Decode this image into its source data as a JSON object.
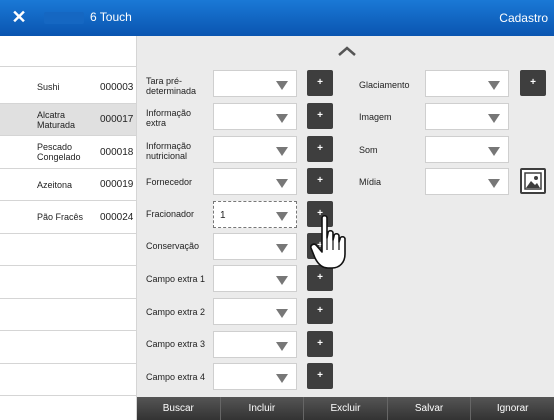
{
  "titlebar": {
    "close": "✕",
    "title": "6 Touch",
    "right_title": "Cadastro"
  },
  "products": [
    {
      "name": "Sushi",
      "code": "000003",
      "selected": false
    },
    {
      "name": "Alcatra Maturada",
      "code": "000017",
      "selected": true
    },
    {
      "name": "Pescado Congelado",
      "code": "000018",
      "selected": false
    },
    {
      "name": "Azeitona",
      "code": "000019",
      "selected": false
    },
    {
      "name": "Pão Fracês",
      "code": "000024",
      "selected": false
    }
  ],
  "fields_left": [
    {
      "label": "Tara pré-determinada",
      "value": ""
    },
    {
      "label": "Informação extra",
      "value": ""
    },
    {
      "label": "Informação nutricional",
      "value": ""
    },
    {
      "label": "Fornecedor",
      "value": ""
    },
    {
      "label": "Fracionador",
      "value": "1"
    },
    {
      "label": "Conservação",
      "value": ""
    },
    {
      "label": "Campo extra 1",
      "value": ""
    },
    {
      "label": "Campo extra 2",
      "value": ""
    },
    {
      "label": "Campo extra 3",
      "value": ""
    },
    {
      "label": "Campo extra 4",
      "value": ""
    }
  ],
  "fields_right": [
    {
      "label": "Glaciamento",
      "value": ""
    },
    {
      "label": "Imagem",
      "value": ""
    },
    {
      "label": "Som",
      "value": ""
    },
    {
      "label": "Mídia",
      "value": ""
    }
  ],
  "plus_label": "+",
  "bottom": {
    "search": "Buscar",
    "add": "Incluir",
    "delete": "Excluir",
    "save": "Salvar",
    "ignore": "Ignorar"
  },
  "icons": {
    "close": "close-icon",
    "chevron": "chevron-up-icon",
    "image": "image-icon",
    "cursor": "hand-pointer-cursor-icon"
  }
}
